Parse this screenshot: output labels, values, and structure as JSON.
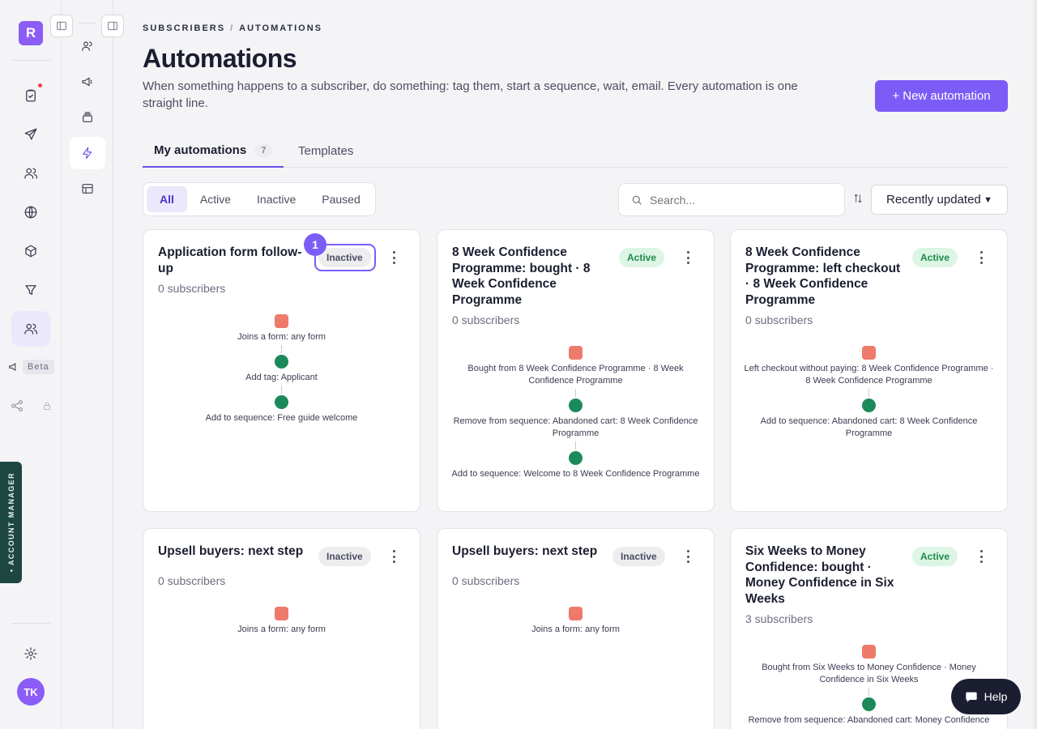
{
  "rail": {
    "logo": "R",
    "beta": "Beta",
    "account_manager": "• ACCOUNT MANAGER",
    "avatar": "TK"
  },
  "breadcrumb": {
    "part1": "SUBSCRIBERS",
    "sep": "/",
    "part2": "AUTOMATIONS"
  },
  "page": {
    "title": "Automations",
    "description": "When something happens to a subscriber, do something: tag them, start a sequence, wait, email. Every automation is one straight line.",
    "new_button": "+ New automation"
  },
  "tabs": {
    "my": "My automations",
    "my_count": "7",
    "templates": "Templates"
  },
  "filters": {
    "all": "All",
    "active": "Active",
    "inactive": "Inactive",
    "paused": "Paused"
  },
  "search": {
    "placeholder": "Search..."
  },
  "sort": {
    "value": "Recently updated"
  },
  "cards": [
    {
      "title": "Application form follow-up",
      "subs": "0 subscribers",
      "status": "Inactive",
      "marker": "1",
      "steps": [
        "Joins a form: any form",
        "Add tag: Applicant",
        "Add to sequence: Free guide welcome"
      ]
    },
    {
      "title": "8 Week Confidence Programme: bought · 8 Week Confidence Programme",
      "subs": "0 subscribers",
      "status": "Active",
      "steps": [
        "Bought from 8 Week Confidence Programme · 8 Week Confidence Programme",
        "Remove from sequence: Abandoned cart: 8 Week Confidence Programme",
        "Add to sequence: Welcome to 8 Week Confidence Programme"
      ]
    },
    {
      "title": "8 Week Confidence Programme: left checkout · 8 Week Confidence Programme",
      "subs": "0 subscribers",
      "status": "Active",
      "steps": [
        "Left checkout without paying: 8 Week Confidence Programme · 8 Week Confidence Programme",
        "Add to sequence: Abandoned cart: 8 Week Confidence Programme"
      ]
    },
    {
      "title": "Upsell buyers: next step",
      "subs": "0 subscribers",
      "status": "Inactive",
      "steps": [
        "Joins a form: any form"
      ]
    },
    {
      "title": "Upsell buyers: next step",
      "subs": "0 subscribers",
      "status": "Inactive",
      "steps": [
        "Joins a form: any form"
      ]
    },
    {
      "title": "Six Weeks to Money Confidence: bought · Money Confidence in Six Weeks",
      "subs": "3 subscribers",
      "status": "Active",
      "steps": [
        "Bought from Six Weeks to Money Confidence · Money Confidence in Six Weeks",
        "Remove from sequence: Abandoned cart: Money Confidence"
      ]
    }
  ],
  "help": "Help"
}
